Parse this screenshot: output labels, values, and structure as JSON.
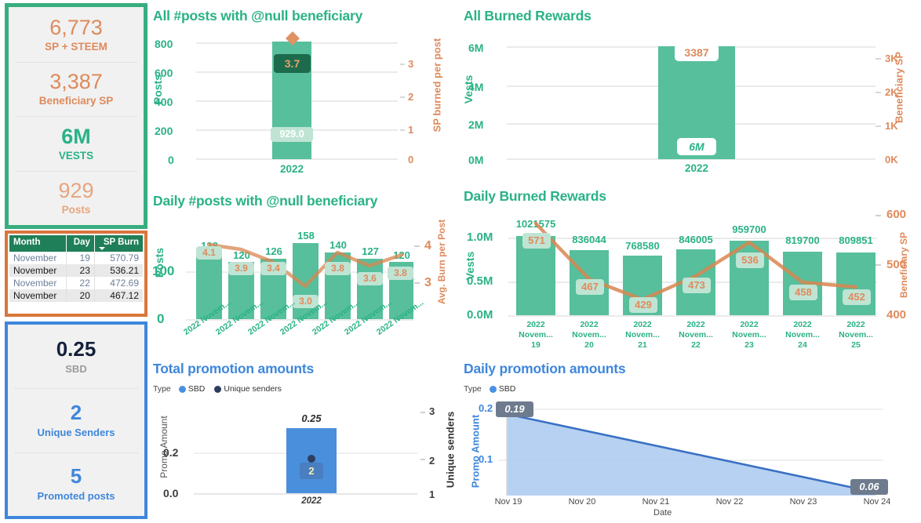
{
  "kpi_panel": {
    "border_color": "#37AD80",
    "cells": [
      {
        "value": "6,773",
        "label": "SP + STEEM",
        "color": "#DE8A5C"
      },
      {
        "value": "3,387",
        "label": "Beneficiary SP",
        "color": "#DE8A5C"
      },
      {
        "value": "6M",
        "label": "VESTS",
        "color": "#2AB287"
      },
      {
        "value": "929",
        "label": "Posts",
        "color": "#E8A57F"
      }
    ]
  },
  "burn_table": {
    "border_color": "#D9763C",
    "columns": [
      "Month",
      "Day",
      "SP Burn"
    ],
    "sorted_column": "SP Burn",
    "rows": [
      {
        "month": "November",
        "day": "19",
        "burn": "570.79"
      },
      {
        "month": "November",
        "day": "23",
        "burn": "536.21"
      },
      {
        "month": "November",
        "day": "22",
        "burn": "472.69"
      },
      {
        "month": "November",
        "day": "20",
        "burn": "467.12"
      }
    ]
  },
  "promo_panel": {
    "border_color": "#3E87DC",
    "cells": [
      {
        "value": "0.25",
        "label": "SBD"
      },
      {
        "value": "2",
        "label": "Unique Senders"
      },
      {
        "value": "5",
        "label": "Promoted posts"
      }
    ]
  },
  "chart_data": [
    {
      "id": "all-posts",
      "type": "bar",
      "title": "All #posts with @null beneficiary",
      "categories": [
        "2022"
      ],
      "series": [
        {
          "name": "Posts",
          "type": "bar",
          "values": [
            929.0
          ],
          "labels": [
            "929.0"
          ],
          "axis": "left"
        },
        {
          "name": "SP burned per post",
          "type": "marker",
          "values": [
            3.7
          ],
          "labels": [
            "3.7"
          ],
          "axis": "right"
        }
      ],
      "ylabel": "Posts",
      "y2label": "SP burned per post",
      "yticks": [
        "0",
        "200",
        "400",
        "600",
        "800"
      ],
      "ylim": [
        0,
        1000
      ],
      "y2ticks": [
        "0",
        "1",
        "2",
        "3"
      ],
      "y2lim": [
        0,
        4
      ],
      "grid": true
    },
    {
      "id": "all-burned",
      "type": "bar",
      "title": "All Burned Rewards",
      "categories": [
        "2022"
      ],
      "series": [
        {
          "name": "Vests",
          "type": "bar",
          "values": [
            6000000
          ],
          "labels": [
            "6M"
          ],
          "axis": "left"
        },
        {
          "name": "Beneficiary SP",
          "type": "label",
          "values": [
            3387
          ],
          "labels": [
            "3387"
          ],
          "axis": "right"
        }
      ],
      "ylabel": "Vests",
      "y2label": "Beneficiary SP",
      "yticks": [
        "0M",
        "2M",
        "4M",
        "6M"
      ],
      "ylim": [
        0,
        6000000
      ],
      "y2ticks": [
        "0K",
        "1K",
        "2K",
        "3K"
      ],
      "y2lim": [
        0,
        3400
      ],
      "grid": true
    },
    {
      "id": "daily-posts",
      "type": "bar",
      "title": "Daily #posts with @null beneficiary",
      "categories": [
        "2022 Novem...",
        "2022 Novem...",
        "2022 Novem...",
        "2022 Novem...",
        "2022 Novem...",
        "2022 Novem...",
        "2022 Novem..."
      ],
      "series": [
        {
          "name": "Posts",
          "type": "bar",
          "axis": "left",
          "values": [
            138,
            120,
            126,
            158,
            140,
            127,
            120
          ],
          "labels": [
            "138",
            "120",
            "126",
            "158",
            "140",
            "127",
            "120"
          ]
        },
        {
          "name": "Avg. Burn per Post",
          "type": "line",
          "axis": "right",
          "values": [
            4.1,
            3.9,
            3.4,
            3.0,
            3.8,
            3.6,
            3.8
          ],
          "labels": [
            "4.1",
            "3.9",
            "3.4",
            "3.0",
            "3.8",
            "3.6",
            "3.8"
          ]
        }
      ],
      "ylabel": "Posts",
      "y2label": "Avg. Burn per Post",
      "yticks": [
        "0",
        "100"
      ],
      "ylim": [
        0,
        175
      ],
      "y2ticks": [
        "3",
        "4"
      ],
      "y2lim": [
        2.7,
        4.25
      ],
      "grid": true
    },
    {
      "id": "daily-burned",
      "type": "bar",
      "title": "Daily Burned Rewards",
      "categories": [
        "2022 Novem... 19",
        "2022 Novem... 20",
        "2022 Novem... 21",
        "2022 Novem... 22",
        "2022 Novem... 23",
        "2022 Novem... 24",
        "2022 Novem... 25"
      ],
      "category_lines": [
        [
          "2022",
          "Novem...",
          "19"
        ],
        [
          "2022",
          "Novem...",
          "20"
        ],
        [
          "2022",
          "Novem...",
          "21"
        ],
        [
          "2022",
          "Novem...",
          "22"
        ],
        [
          "2022",
          "Novem...",
          "23"
        ],
        [
          "2022",
          "Novem...",
          "24"
        ],
        [
          "2022",
          "Novem...",
          "25"
        ]
      ],
      "series": [
        {
          "name": "Vests",
          "type": "bar",
          "axis": "left",
          "values": [
            1021575,
            836044,
            768580,
            846005,
            959700,
            819700,
            809851
          ],
          "labels": [
            "1021575",
            "836044",
            "768580",
            "846005",
            "959700",
            "819700",
            "809851"
          ]
        },
        {
          "name": "Beneficiary SP",
          "type": "line",
          "axis": "right",
          "values": [
            571,
            467,
            429,
            473,
            536,
            458,
            452
          ],
          "labels": [
            "571",
            "467",
            "429",
            "473",
            "536",
            "458",
            "452"
          ]
        }
      ],
      "ylabel": "Vests",
      "y2label": "Beneficiary SP",
      "yticks": [
        "0.0M",
        "0.5M",
        "1.0M"
      ],
      "ylim": [
        0,
        1100000
      ],
      "y2ticks": [
        "400",
        "500",
        "600"
      ],
      "y2lim": [
        400,
        600
      ],
      "grid": true
    },
    {
      "id": "total-promo",
      "type": "bar",
      "title": "Total promotion amounts",
      "legend_title": "Type",
      "legend": [
        {
          "label": "SBD",
          "color": "#4A90E2"
        },
        {
          "label": "Unique senders",
          "color": "#2E3E60"
        }
      ],
      "categories": [
        "2022"
      ],
      "series": [
        {
          "name": "SBD",
          "type": "bar",
          "axis": "left",
          "values": [
            0.25
          ],
          "labels": [
            "0.25"
          ]
        },
        {
          "name": "Unique senders",
          "type": "marker",
          "axis": "right",
          "values": [
            2
          ],
          "labels": [
            "2"
          ]
        }
      ],
      "ylabel": "Promo Amount",
      "y2label": "Unique senders",
      "yticks": [
        "0.0",
        "0.2"
      ],
      "ylim": [
        0,
        0.28
      ],
      "y2ticks": [
        "1",
        "2",
        "3"
      ],
      "y2lim": [
        1,
        3
      ],
      "grid": true
    },
    {
      "id": "daily-promo",
      "type": "area",
      "title": "Daily promotion amounts",
      "legend_title": "Type",
      "legend": [
        {
          "label": "SBD",
          "color": "#4A90E2"
        }
      ],
      "x": [
        "Nov 19",
        "Nov 20",
        "Nov 21",
        "Nov 22",
        "Nov 23",
        "Nov 24"
      ],
      "series": [
        {
          "name": "SBD",
          "type": "area",
          "values": [
            0.19,
            null,
            null,
            null,
            null,
            0.06
          ],
          "labels": [
            "0.19",
            "0.06"
          ]
        }
      ],
      "xlabel": "Date",
      "ylabel": "Promo Amount",
      "yticks": [
        "0.1",
        "0.2"
      ],
      "ylim": [
        0.04,
        0.205
      ],
      "grid": true
    }
  ],
  "colors": {
    "bar_green": "#57BF9C",
    "title_green": "#2AB287",
    "orange": "#DE8A5C",
    "line_orange": "#D9854F",
    "blue": "#4A90E2",
    "navy": "#2E3E60"
  }
}
